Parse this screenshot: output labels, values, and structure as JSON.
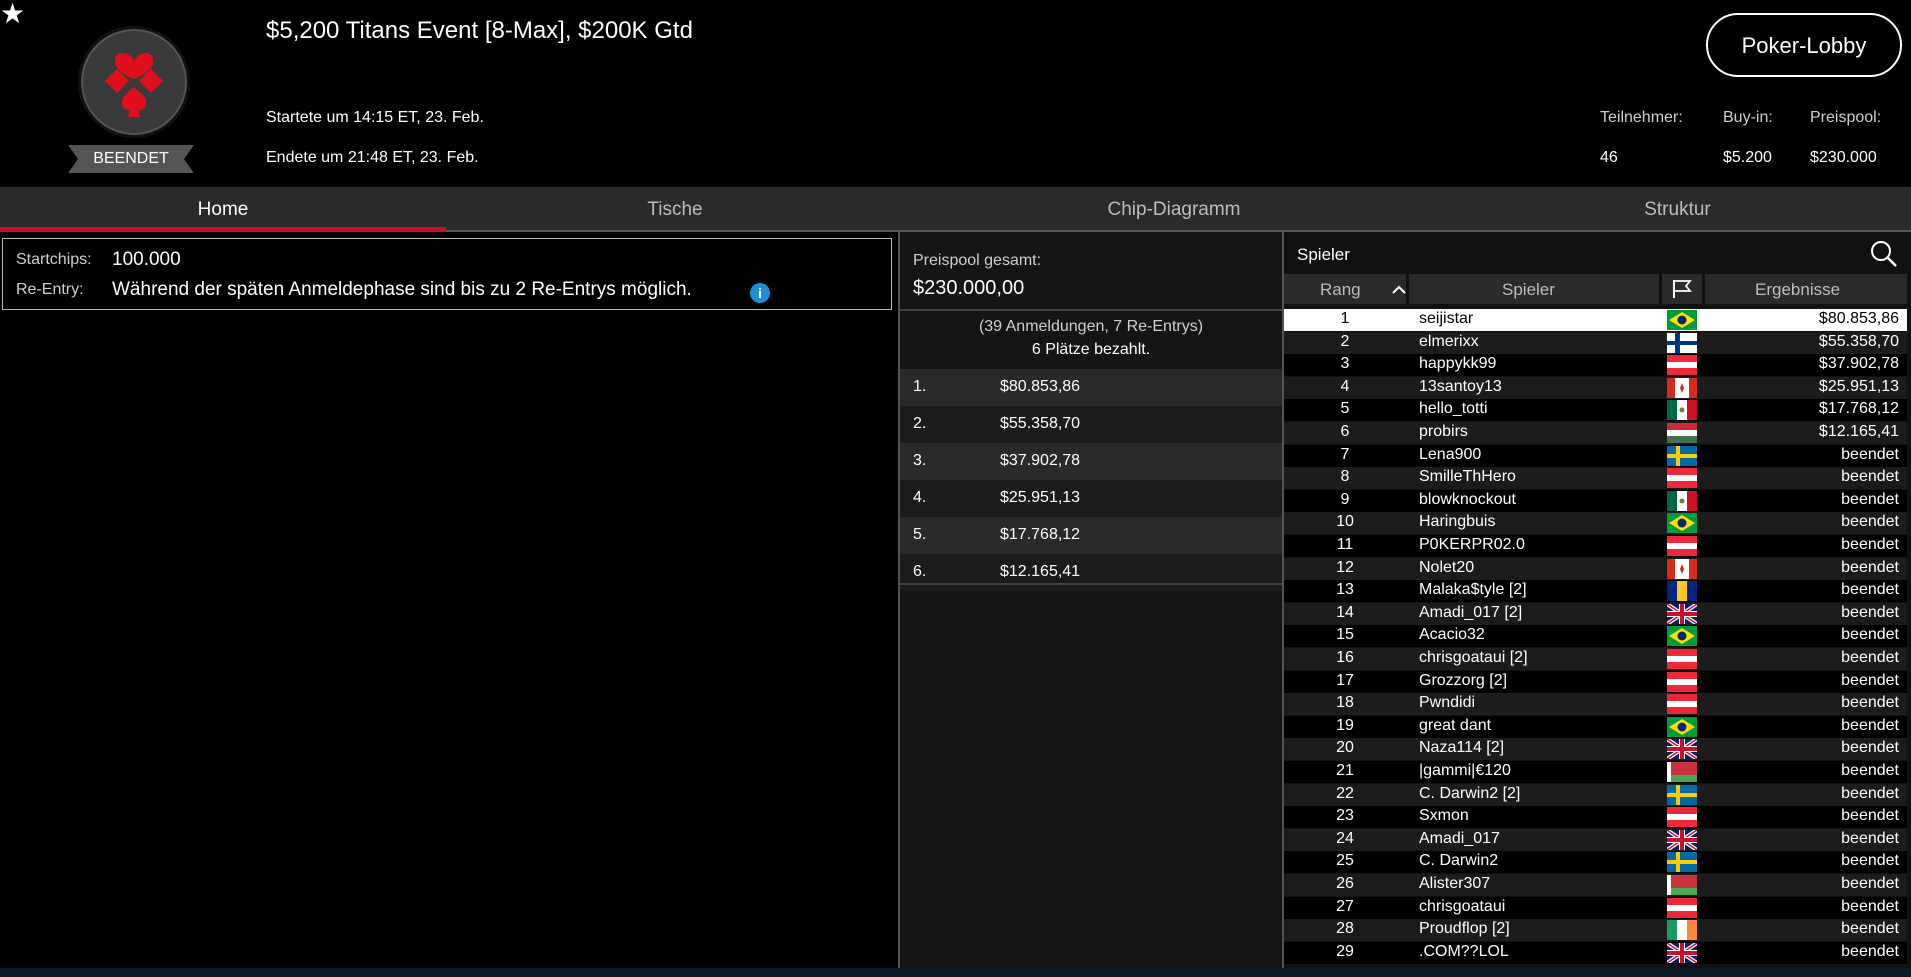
{
  "header": {
    "title": "$5,200 Titans Event [8-Max], $200K Gtd",
    "started": "Startete um 14:15 ET, 23. Feb.",
    "ended": "Endete um 21:48 ET, 23. Feb.",
    "status_badge": "BEENDET",
    "lobby_button": "Poker-Lobby",
    "stats": {
      "players_label": "Teilnehmer:",
      "players_value": "46",
      "buyin_label": "Buy-in:",
      "buyin_value": "$5.200",
      "prizepool_label": "Preispool:",
      "prizepool_value": "$230.000"
    }
  },
  "tabs": [
    {
      "label": "Home",
      "active": true
    },
    {
      "label": "Tische",
      "active": false
    },
    {
      "label": "Chip-Diagramm",
      "active": false
    },
    {
      "label": "Struktur",
      "active": false
    }
  ],
  "info": {
    "startchips_label": "Startchips:",
    "startchips_value": "100.000",
    "reentry_label": "Re-Entry:",
    "reentry_value": "Während der späten Anmeldephase sind bis zu 2 Re-Entrys möglich.",
    "info_icon": "info-icon"
  },
  "prizepool": {
    "label": "Preispool gesamt:",
    "value": "$230.000,00",
    "registrations": "(39 Anmeldungen, 7 Re-Entrys)",
    "paid_places": "6 Plätze bezahlt.",
    "payouts": [
      {
        "place": "1.",
        "amount": "$80.853,86"
      },
      {
        "place": "2.",
        "amount": "$55.358,70"
      },
      {
        "place": "3.",
        "amount": "$37.902,78"
      },
      {
        "place": "4.",
        "amount": "$25.951,13"
      },
      {
        "place": "5.",
        "amount": "$17.768,12"
      },
      {
        "place": "6.",
        "amount": "$12.165,41"
      }
    ]
  },
  "players": {
    "title": "Spieler",
    "columns": {
      "rank": "Rang",
      "player": "Spieler",
      "flag": "flag-icon",
      "results": "Ergebnisse"
    },
    "rows": [
      {
        "rank": "1",
        "name": "seijistar",
        "flag": "brazil",
        "result": "$80.853,86"
      },
      {
        "rank": "2",
        "name": "elmerixx",
        "flag": "finland",
        "result": "$55.358,70"
      },
      {
        "rank": "3",
        "name": "happykk99",
        "flag": "austria",
        "result": "$37.902,78"
      },
      {
        "rank": "4",
        "name": "13santoy13",
        "flag": "canada",
        "result": "$25.951,13"
      },
      {
        "rank": "5",
        "name": "hello_totti",
        "flag": "mexico",
        "result": "$17.768,12"
      },
      {
        "rank": "6",
        "name": "probirs",
        "flag": "hungary",
        "result": "$12.165,41"
      },
      {
        "rank": "7",
        "name": "Lena900",
        "flag": "sweden",
        "result": "beendet"
      },
      {
        "rank": "8",
        "name": "SmilleThHero",
        "flag": "austria",
        "result": "beendet"
      },
      {
        "rank": "9",
        "name": "blowknockout",
        "flag": "mexico",
        "result": "beendet"
      },
      {
        "rank": "10",
        "name": "Haringbuis",
        "flag": "brazil",
        "result": "beendet"
      },
      {
        "rank": "11",
        "name": "P0KERPR02.0",
        "flag": "austria",
        "result": "beendet"
      },
      {
        "rank": "12",
        "name": "Nolet20",
        "flag": "canada",
        "result": "beendet"
      },
      {
        "rank": "13",
        "name": "Malaka$tyle [2]",
        "flag": "barbados",
        "result": "beendet"
      },
      {
        "rank": "14",
        "name": "Amadi_017 [2]",
        "flag": "uk",
        "result": "beendet"
      },
      {
        "rank": "15",
        "name": "Acacio32",
        "flag": "brazil",
        "result": "beendet"
      },
      {
        "rank": "16",
        "name": "chrisgoataui [2]",
        "flag": "austria",
        "result": "beendet"
      },
      {
        "rank": "17",
        "name": "Grozzorg [2]",
        "flag": "austria",
        "result": "beendet"
      },
      {
        "rank": "18",
        "name": "Pwndidi",
        "flag": "austria",
        "result": "beendet"
      },
      {
        "rank": "19",
        "name": "great dant",
        "flag": "brazil",
        "result": "beendet"
      },
      {
        "rank": "20",
        "name": "Naza114 [2]",
        "flag": "uk",
        "result": "beendet"
      },
      {
        "rank": "21",
        "name": "|gammi|€120",
        "flag": "belarus",
        "result": "beendet"
      },
      {
        "rank": "22",
        "name": "C. Darwin2 [2]",
        "flag": "sweden",
        "result": "beendet"
      },
      {
        "rank": "23",
        "name": "Sxmon",
        "flag": "austria",
        "result": "beendet"
      },
      {
        "rank": "24",
        "name": "Amadi_017",
        "flag": "uk",
        "result": "beendet"
      },
      {
        "rank": "25",
        "name": "C. Darwin2",
        "flag": "sweden",
        "result": "beendet"
      },
      {
        "rank": "26",
        "name": "Alister307",
        "flag": "belarus",
        "result": "beendet"
      },
      {
        "rank": "27",
        "name": "chrisgoataui",
        "flag": "austria",
        "result": "beendet"
      },
      {
        "rank": "28",
        "name": "Proudflop [2]",
        "flag": "ireland",
        "result": "beendet"
      },
      {
        "rank": "29",
        "name": ".COM??LOL",
        "flag": "uk",
        "result": "beendet"
      }
    ]
  },
  "colors": {
    "accent_red": "#c8102e",
    "background": "#000000",
    "info_blue": "#1e8fd6"
  }
}
